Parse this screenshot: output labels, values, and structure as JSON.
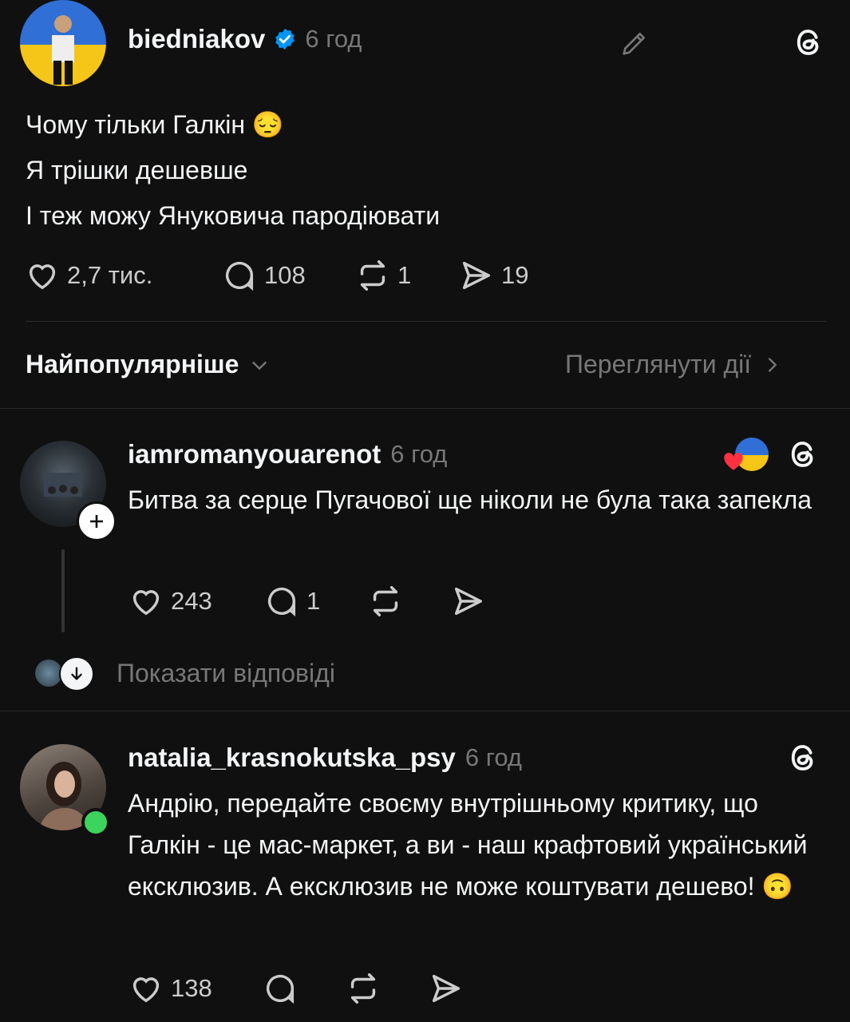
{
  "post": {
    "username": "biedniakov",
    "time": "6 год",
    "lines": [
      "Чому тільки Галкін 😔",
      "Я трішки дешевше",
      "І теж можу Януковича пародіювати"
    ],
    "likes": "2,7 тис.",
    "replies": "108",
    "reposts": "1",
    "shares": "19"
  },
  "sort": {
    "label": "Найпопулярніше",
    "activity_link": "Переглянути дії"
  },
  "comments": [
    {
      "username": "iamromanyouarenot",
      "time": "6 год",
      "text": "Битва за серце Пугачової ще ніколи не була така запекла",
      "likes": "243",
      "replies": "1",
      "show_replies": "Показати відповіді"
    },
    {
      "username": "natalia_krasnokutska_psy",
      "time": "6 год",
      "text": "Андрію, передайте своєму внутрішньому критику, що Галкін - це мас-маркет, а ви - наш крафтовий український ексклюзив. А ексклюзив не може коштувати дешево! 🙃",
      "likes": "138"
    }
  ],
  "icons": [
    "verified-badge-icon",
    "edit-icon",
    "threads-logo-icon",
    "heart-icon",
    "comment-icon",
    "repost-icon",
    "share-icon",
    "chevron-down-icon",
    "chevron-right-icon",
    "plus-icon",
    "arrow-down-icon",
    "online-status-icon"
  ],
  "colors": {
    "background": "#101010",
    "verified": "#0095f6",
    "online": "#3cd45c",
    "muted": "#777777"
  }
}
